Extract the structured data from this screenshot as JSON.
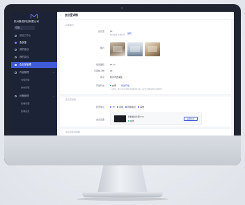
{
  "sidebar": {
    "company": "杭州集成科技有限公司",
    "selector": "切换 ⌄",
    "items": [
      {
        "label": "返回工作台"
      },
      {
        "label": "会议室"
      },
      {
        "label": "我的会议"
      },
      {
        "label": "我的会议"
      },
      {
        "label": "会议室管理"
      },
      {
        "label": "内容管理"
      },
      {
        "label": "内容管理"
      },
      {
        "label": "素材管理"
      },
      {
        "label": "设备管理"
      },
      {
        "label": "终端管理"
      },
      {
        "label": "终端设置"
      }
    ]
  },
  "header": {
    "back": "‹",
    "title": "会议室详情"
  },
  "sections": {
    "basic": "基本信息",
    "device": "会议室设备",
    "other": "会议室使用限制"
  },
  "fields": {
    "name_label": "会议室",
    "name_value": "3F",
    "name_sub": "杭州总部-大会议室",
    "name_link": "编辑",
    "photo_label": "图片",
    "area_label": "使用面积",
    "area_value": "50 m²",
    "capacity_label": "可容纳人数",
    "capacity_value": "20",
    "location_label": "地点",
    "location_value": "杭州市西湖区",
    "status_label": "开放状态",
    "status_value": "启用",
    "status_link": "修改开放",
    "status_note": "1. 启用后，用户可在会议预约页面看到会议室，进行会议预约操作及其他使用",
    "mode_label": "配置信息",
    "mode_options": [
      "TV",
      "白板",
      "视频会议",
      "其他"
    ],
    "device_label": "会议设备",
    "device_name": "智能会议大屏 P10",
    "device_status": "在线",
    "device_button": "设备信息"
  },
  "colors": {
    "accent": "#3f5bd8",
    "sidebar": "#1d2336",
    "online": "#2bb673"
  }
}
